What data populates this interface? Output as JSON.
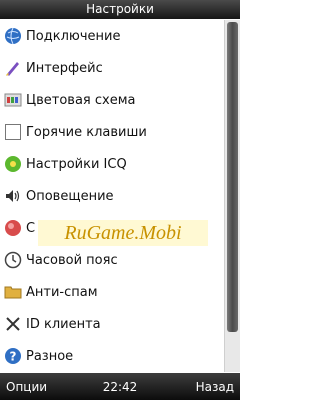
{
  "window": {
    "title": "Настройки"
  },
  "menu": {
    "items": [
      {
        "label": "Подключение",
        "icon": "globe-icon"
      },
      {
        "label": "Интерфейс",
        "icon": "brush-icon"
      },
      {
        "label": "Цветовая схема",
        "icon": "palette-icon"
      },
      {
        "label": "Горячие клавиши",
        "icon": "key-icon"
      },
      {
        "label": "Настройки ICQ",
        "icon": "icq-flower-icon"
      },
      {
        "label": "Оповещение",
        "icon": "speaker-icon"
      },
      {
        "label": "С",
        "icon": "status-icon"
      },
      {
        "label": "Часовой пояс",
        "icon": "clock-icon"
      },
      {
        "label": "Анти-спам",
        "icon": "folder-icon"
      },
      {
        "label": "ID клиента",
        "icon": "id-icon"
      },
      {
        "label": "Разное",
        "icon": "question-icon"
      }
    ]
  },
  "watermark": {
    "text": "RuGame.Mobi"
  },
  "softkeys": {
    "left": "Опции",
    "time": "22:42",
    "right": "Назад"
  },
  "colors": {
    "bar": "#1a1a1a",
    "accent": "#2f6fc4",
    "watermark": "#c89200"
  }
}
